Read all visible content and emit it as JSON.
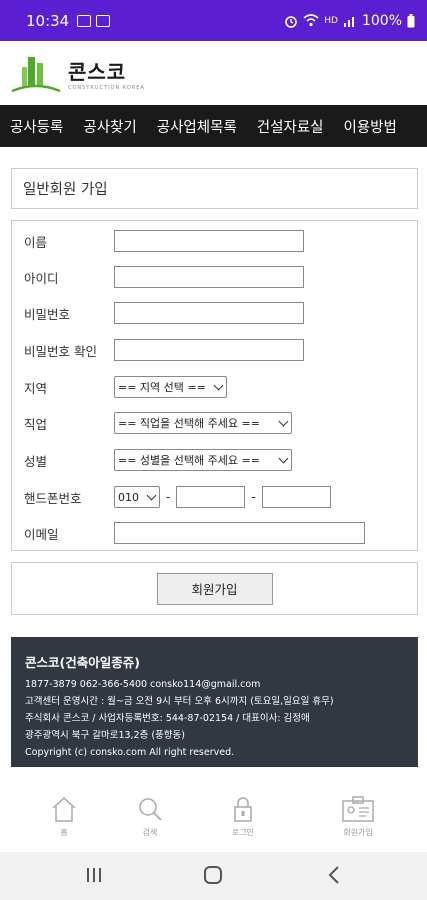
{
  "status_bar": {
    "time": "10:34",
    "battery": "100%",
    "network": "HD"
  },
  "header": {
    "brand_name": "콘스코",
    "brand_sub": "CONSTRUCTION KOREA",
    "logo_color": "#4caa2a"
  },
  "nav": {
    "items": [
      "공사등록",
      "공사찾기",
      "공사업체목록",
      "건설자료실",
      "이용방법"
    ]
  },
  "form": {
    "title": "일반회원 가입",
    "fields": {
      "name_label": "이름",
      "id_label": "아이디",
      "password_label": "비밀번호",
      "password_confirm_label": "비밀번호 확인",
      "region_label": "지역",
      "region_value": "== 지역 선택 ==",
      "job_label": "직업",
      "job_value": "== 직업을 선택해 주세요 ==",
      "gender_label": "성별",
      "gender_value": "== 성별을 선택해 주세요 ==",
      "phone_label": "핸드폰번호",
      "phone_prefix": "010",
      "phone_dash": "-",
      "email_label": "이메일"
    },
    "submit_label": "회원가입"
  },
  "footer": {
    "company": "콘스코(건축아일종쥬)",
    "line1": "1877-3879   062-366-5400   consko114@gmail.com",
    "line2": "고객센터 운영시간 : 월~금 오전 9시 부터 오후 6시까지 (토요일,일요일 휴무)",
    "line3": "주식회사 콘스코 / 사업자등록번호: 544-87-02154 / 대표이사: 김정애",
    "line4": "광주광역시 북구 갈마로13,2층 (풍향동)",
    "line5": "Copyright (c) consko.com All right reserved.",
    "bg_color": "#323841"
  },
  "tabbar": {
    "home": "홈",
    "search": "검색",
    "login": "로그인",
    "signup": "회원가입"
  },
  "colors": {
    "status_bar": "#5b1fd1",
    "nav_bg": "#1a1a1a"
  }
}
